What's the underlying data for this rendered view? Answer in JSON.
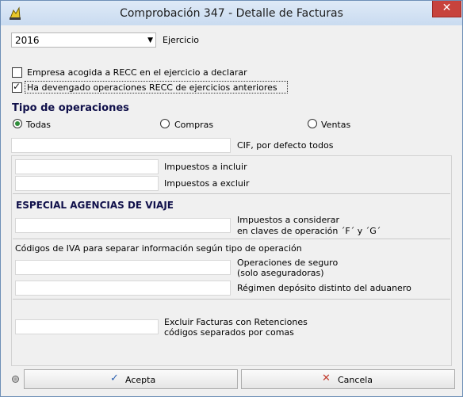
{
  "window": {
    "title": "Comprobación 347 - Detalle de Facturas",
    "close_glyph": "✕",
    "accent": "#c7433d"
  },
  "ejercicio": {
    "value": "2016",
    "label": "Ejercicio"
  },
  "checks": {
    "recc_label": "Empresa acogida a RECC en el ejercicio a declarar",
    "recc_checked": false,
    "devengado_label": "Ha devengado operaciones RECC de ejercicios anteriores",
    "devengado_checked": true
  },
  "tipo_operaciones": {
    "title": "Tipo de operaciones",
    "options": [
      "Todas",
      "Compras",
      "Ventas"
    ],
    "selected": "Todas"
  },
  "cif": {
    "value": "",
    "label": "CIF, por defecto todos"
  },
  "impuestos": {
    "incluir_label": "Impuestos a incluir",
    "excluir_label": "Impuestos a excluir",
    "incluir_value": "",
    "excluir_value": ""
  },
  "agencias": {
    "title": "ESPECIAL AGENCIAS DE VIAJE",
    "considerar_label_1": "Impuestos a considerar",
    "considerar_label_2": "en claves de operación ´F´ y ´G´",
    "considerar_value": ""
  },
  "codigos_iva": {
    "title": "Códigos de IVA para separar información según tipo de operación",
    "seguro_label_1": "Operaciones de seguro",
    "seguro_label_2": "(solo aseguradoras)",
    "deposito_label": "Régimen depósito distinto del aduanero",
    "seguro_value": "",
    "deposito_value": ""
  },
  "retenciones": {
    "label_1": "Excluir Facturas con Retenciones",
    "label_2": "códigos separados por comas",
    "value": ""
  },
  "buttons": {
    "accept": "Acepta",
    "cancel": "Cancela",
    "accept_icon": "check-icon",
    "cancel_icon": "cross-icon",
    "accept_color": "#2a5fb0",
    "cancel_color": "#c0392b"
  }
}
